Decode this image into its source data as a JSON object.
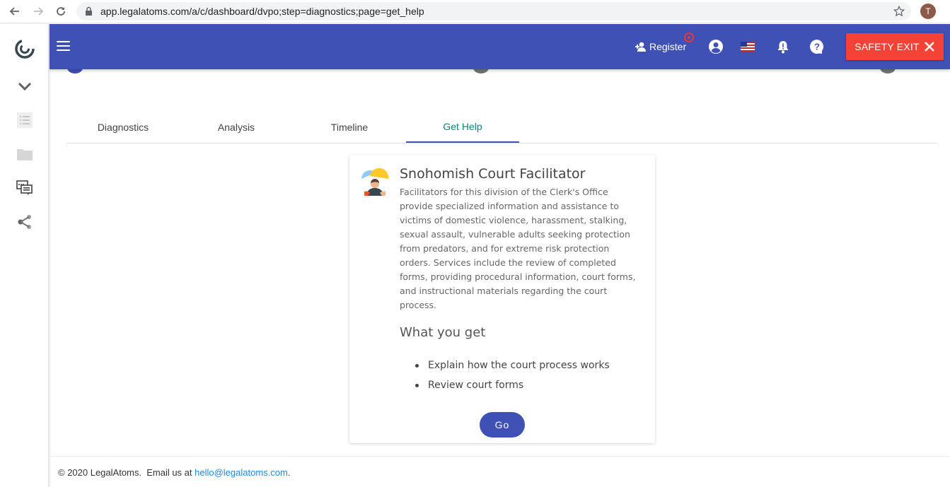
{
  "browser": {
    "url": "app.legalatoms.com/a/c/dashboard/dvpo;step=diagnostics;page=get_help",
    "profile_initial": "T"
  },
  "rail": {
    "items": [
      "logo-icon",
      "chevron-down-icon",
      "list-icon",
      "folder-icon",
      "chat-icon",
      "share-icon"
    ]
  },
  "header": {
    "register_label": "Register",
    "safety_exit_label": "SAFETY EXIT",
    "icons": [
      "account-icon",
      "us-flag-icon",
      "bell-icon",
      "help-icon"
    ]
  },
  "tabs": [
    {
      "label": "Diagnostics",
      "active": false
    },
    {
      "label": "Analysis",
      "active": false
    },
    {
      "label": "Timeline",
      "active": false
    },
    {
      "label": "Get Help",
      "active": true
    }
  ],
  "card": {
    "title": "Snohomish Court Facilitator",
    "description": "Facilitators for this division of the Clerk's Office provide specialized information and assistance to victims of domestic violence, harassment, stalking, sexual assault, vulnerable adults seeking protection from predators, and for extreme risk protection orders. Services include the review of completed forms, providing procedural information, court forms, and instructional materials regarding the court process.",
    "subheading": "What you get",
    "benefits": [
      "Explain how the court process works",
      "Review court forms"
    ],
    "go_label": "Go"
  },
  "footer": {
    "copyright": "© 2020 LegalAtoms.  Email us at ",
    "email": "hello@legalatoms.com",
    "suffix": "."
  },
  "colors": {
    "primary": "#3f51b5",
    "danger": "#f44336",
    "active_tab_text": "#00897b"
  }
}
